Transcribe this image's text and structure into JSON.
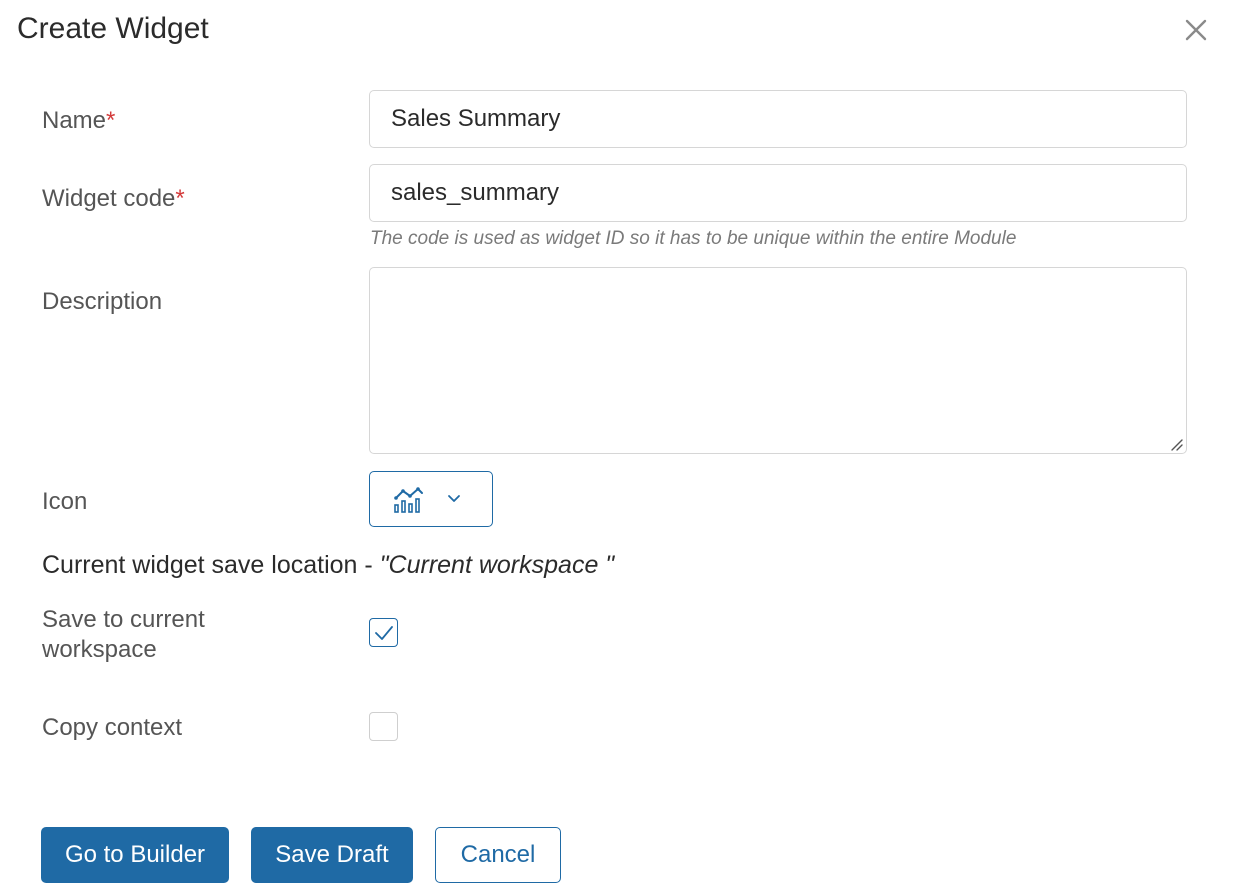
{
  "dialog": {
    "title": "Create Widget",
    "close_icon": "close-icon"
  },
  "form": {
    "name": {
      "label": "Name",
      "required_mark": "*",
      "value": "Sales Summary"
    },
    "widget_code": {
      "label": "Widget code",
      "required_mark": "*",
      "value": "sales_summary",
      "hint": "The code is used as widget ID so it has to be unique within the entire Module"
    },
    "description": {
      "label": "Description",
      "value": ""
    },
    "icon": {
      "label": "Icon",
      "selected_icon": "chart-analytics-icon",
      "dropdown_icon": "chevron-down-icon"
    },
    "save_location": {
      "prefix": "Current widget save location - ",
      "value": "\"Current workspace \""
    },
    "save_to_current": {
      "label": "Save to current workspace",
      "checked": true
    },
    "copy_context": {
      "label": "Copy context",
      "checked": false
    }
  },
  "footer": {
    "go_to_builder_label": "Go to Builder",
    "save_draft_label": "Save Draft",
    "cancel_label": "Cancel"
  },
  "colors": {
    "accent": "#1f6aa5",
    "required": "#d33a3a",
    "label": "#555555",
    "hint": "#7a7a7a"
  }
}
